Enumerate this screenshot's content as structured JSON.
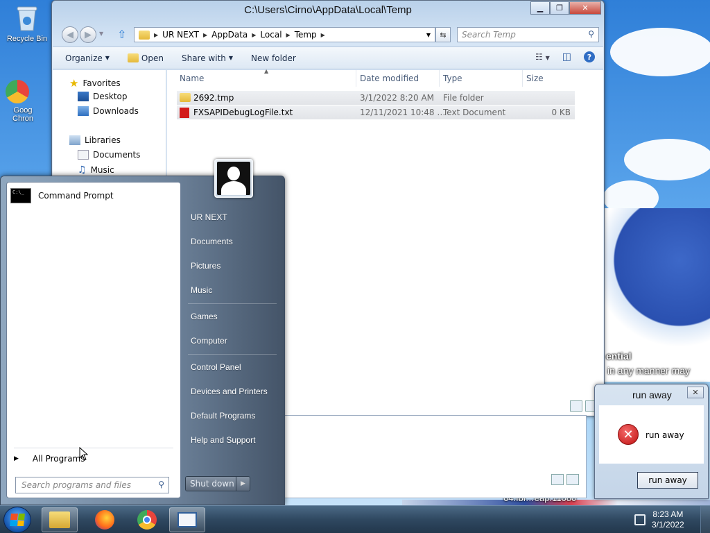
{
  "desktop": {
    "icons": [
      {
        "label": "Recycle Bin"
      },
      {
        "label": "Goog Chron"
      }
    ],
    "overlay_lines": [
      "ential",
      "in any manner may",
      "64.fbl…eap.11080"
    ]
  },
  "explorer": {
    "title": "C:\\Users\\Cirno\\AppData\\Local\\Temp",
    "breadcrumb": [
      "UR NEXT",
      "AppData",
      "Local",
      "Temp"
    ],
    "search_placeholder": "Search Temp",
    "toolbar": {
      "organize": "Organize",
      "open": "Open",
      "share_with": "Share with",
      "new_folder": "New folder"
    },
    "nav": {
      "favorites": "Favorites",
      "desktop": "Desktop",
      "downloads": "Downloads",
      "libraries": "Libraries",
      "documents": "Documents",
      "music": "Music"
    },
    "columns": {
      "name": "Name",
      "date_modified": "Date modified",
      "type": "Type",
      "size": "Size"
    },
    "files": [
      {
        "name": "2692.tmp",
        "date": "3/1/2022 8:20 AM",
        "type": "File folder",
        "size": ""
      },
      {
        "name": "FXSAPIDebugLogFile.txt",
        "date": "12/11/2021 10:48 …",
        "type": "Text Document",
        "size": "0 KB"
      }
    ]
  },
  "start_menu": {
    "pinned": [
      {
        "label": "Command Prompt",
        "icon": "cmd-icon"
      }
    ],
    "all_programs": "All Programs",
    "search_placeholder": "Search programs and files",
    "right_items": [
      "UR NEXT",
      "Documents",
      "Pictures",
      "Music",
      "Games",
      "Computer",
      "Control Panel",
      "Devices and Printers",
      "Default Programs",
      "Help and Support"
    ],
    "shutdown": "Shut down"
  },
  "dialog": {
    "title": "run away",
    "message": "run away",
    "button": "run away"
  },
  "taskbar": {
    "time": "8:23 AM",
    "date": "3/1/2022"
  }
}
